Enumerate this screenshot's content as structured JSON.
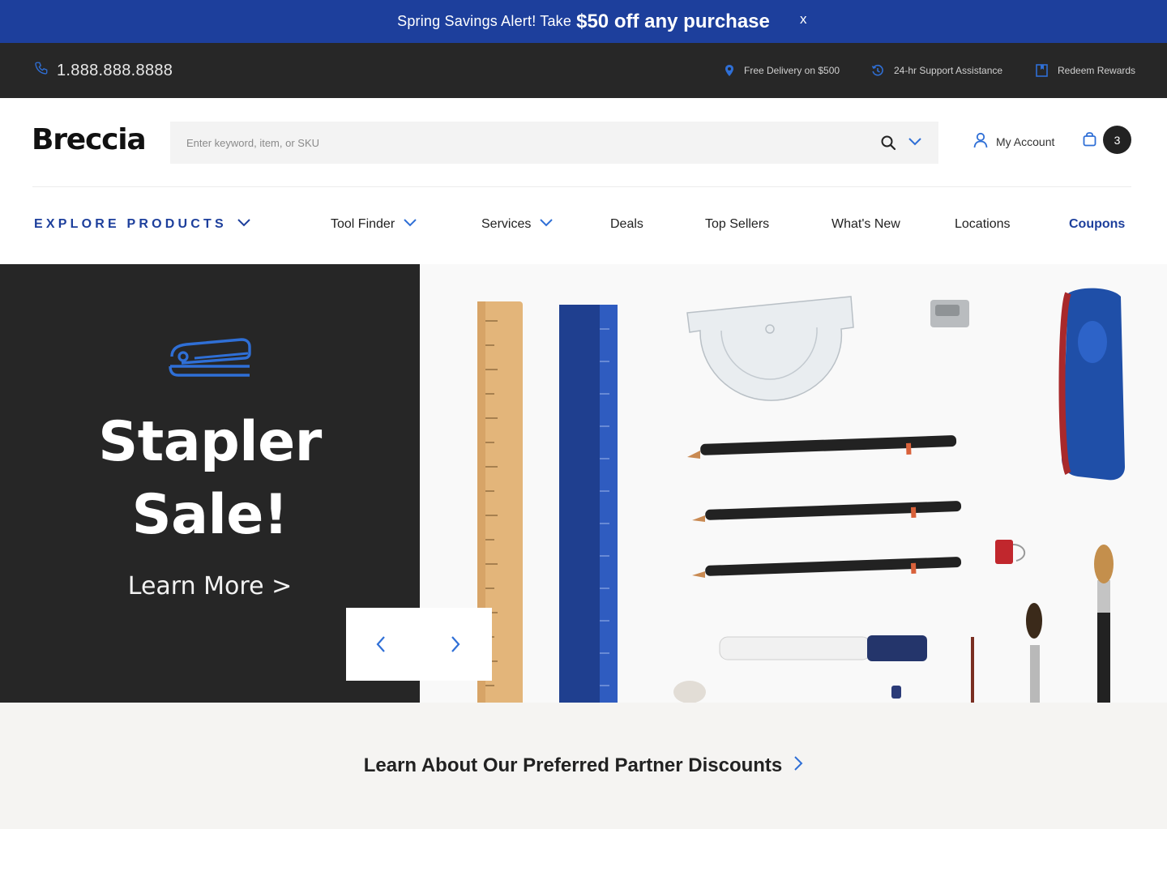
{
  "promo": {
    "text": "Spring Savings Alert! Take",
    "highlight": "$50 off any purchase",
    "close_label": "x"
  },
  "utility": {
    "phone": "1.888.888.8888",
    "delivery": "Free Delivery on $500",
    "support": "24-hr Support Assistance",
    "rewards": "Redeem Rewards"
  },
  "header": {
    "logo": "Breccia",
    "search_placeholder": "Enter keyword, item, or SKU",
    "account_label": "My Account",
    "cart_count": "3"
  },
  "nav": {
    "explore_label": "EXPLORE PRODUCTS",
    "items": [
      {
        "label": "Tool Finder"
      },
      {
        "label": "Services"
      },
      {
        "label": "Deals"
      },
      {
        "label": "Top Sellers"
      },
      {
        "label": "What's New"
      },
      {
        "label": "Locations"
      },
      {
        "label": "Coupons"
      }
    ]
  },
  "hero": {
    "title_line1": "Stapler",
    "title_line2": "Sale!",
    "link_label": "Learn More >"
  },
  "partner": {
    "link_label": "Learn About Our Preferred Partner Discounts"
  },
  "colors": {
    "brand_blue": "#1d3f9c",
    "icon_blue": "#2f6fd6",
    "dark": "#262626"
  },
  "icons": [
    "phone-icon",
    "location-pin-icon",
    "history-icon",
    "bookmark-icon",
    "search-icon",
    "chevron-down-icon",
    "user-icon",
    "bag-icon",
    "stapler-icon",
    "chevron-left-icon",
    "chevron-right-icon"
  ]
}
